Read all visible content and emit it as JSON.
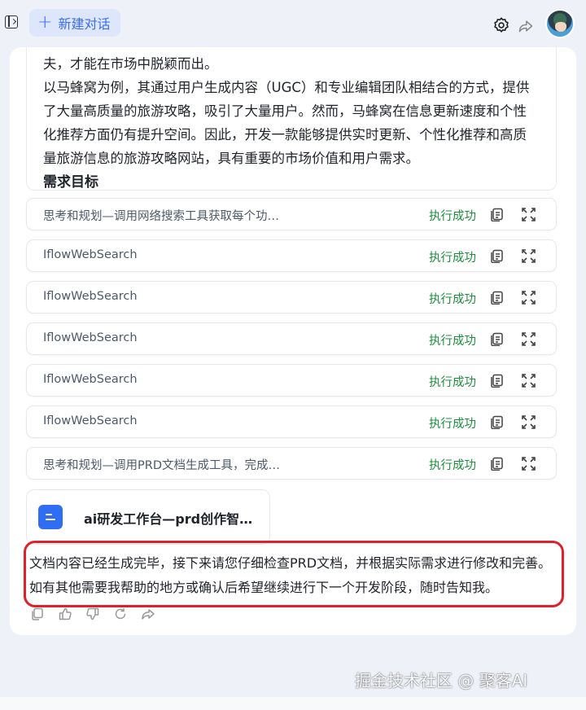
{
  "header": {
    "new_chat_label": "新建对话"
  },
  "document": {
    "paragraphs": [
      "夫，才能在市场中脱颖而出。",
      "以马蜂窝为例，其通过用户生成内容（UGC）和专业编辑团队相结合的方式，提供了大量高质量的旅游攻略，吸引了大量用户。然而，马蜂窝在信息更新速度和个性化推荐方面仍有提升空间。因此，开发一款能够提供实时更新、个性化推荐和高质量旅游信息的旅游攻略网站，具有重要的市场价值和用户需求。"
    ],
    "heading": "需求目标"
  },
  "tool_calls": [
    {
      "name": "思考和规划—调用网络搜索工具获取每个功…",
      "status": "执行成功"
    },
    {
      "name": "IflowWebSearch",
      "status": "执行成功"
    },
    {
      "name": "IflowWebSearch",
      "status": "执行成功"
    },
    {
      "name": "IflowWebSearch",
      "status": "执行成功"
    },
    {
      "name": "IflowWebSearch",
      "status": "执行成功"
    },
    {
      "name": "IflowWebSearch",
      "status": "执行成功"
    },
    {
      "name": "思考和规划—调用PRD文档生成工具，完成…",
      "status": "执行成功"
    }
  ],
  "file_card": {
    "title": "ai研发工作台—prd创作智…"
  },
  "final_message": "文档内容已经生成完毕，接下来请您仔细检查PRD文档，并根据实际需求进行修改和完善。如有其他需要我帮助的地方或确认后希望继续进行下一个开发阶段，随时告知我。",
  "watermark": "掘金技术社区 @ 聚客AI",
  "colors": {
    "accent": "#3a6df0",
    "success": "#1e8e3e",
    "highlight_border": "#e0202a"
  }
}
